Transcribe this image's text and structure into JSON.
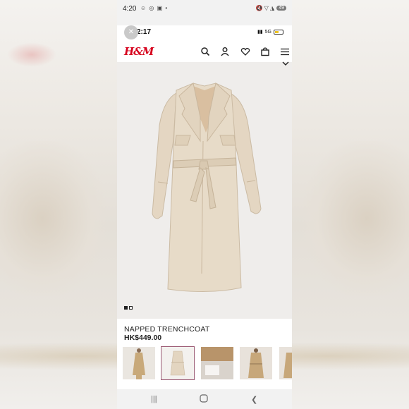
{
  "device_status": {
    "time": "4:20",
    "notification_icons": "☺ ◎ ▣ •",
    "right_icons": "🔇 ▽ ◮",
    "battery": "49"
  },
  "screenshot_status": {
    "time": "2:17",
    "network": "5G",
    "close_icon": "close-icon"
  },
  "header": {
    "logo": "H&M",
    "icons": [
      "search-icon",
      "account-icon",
      "favorites-icon",
      "bag-icon",
      "menu-icon"
    ]
  },
  "product": {
    "name": "NAPPED TRENCHCOAT",
    "price": "HK$449.00",
    "image_index": 1,
    "image_count": 2,
    "coat_color": "#e5d8c5"
  },
  "thumbnails": [
    {
      "label": "model-front",
      "selected": false
    },
    {
      "label": "flat-front",
      "selected": true
    },
    {
      "label": "fabric-detail",
      "selected": false
    },
    {
      "label": "model-belted",
      "selected": false
    },
    {
      "label": "model-side",
      "selected": false
    }
  ],
  "system_nav": [
    "recents-button",
    "home-button",
    "back-button"
  ],
  "colors": {
    "brand": "#d6001c",
    "selected_thumb_border": "#9b5a74"
  }
}
